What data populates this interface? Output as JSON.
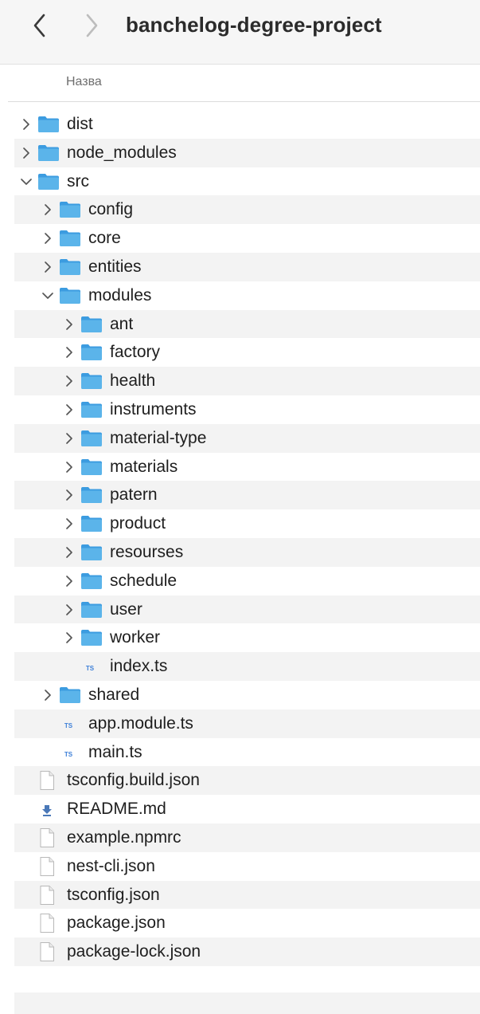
{
  "window": {
    "title": "banchelog-degree-project",
    "back_icon": "chevron-left-icon",
    "forward_icon": "chevron-right-icon"
  },
  "column_header": {
    "name": "Назва"
  },
  "colors": {
    "folder": "#5bb4ea",
    "folder_tab": "#3c9ce0",
    "stripe": "#f3f3f3",
    "ts_badge": "#3d7fd8"
  },
  "rows": [
    {
      "name": "dist",
      "kind": "folder",
      "depth": 0,
      "state": "collapsed"
    },
    {
      "name": "node_modules",
      "kind": "folder",
      "depth": 0,
      "state": "collapsed"
    },
    {
      "name": "src",
      "kind": "folder",
      "depth": 0,
      "state": "expanded"
    },
    {
      "name": "config",
      "kind": "folder",
      "depth": 1,
      "state": "collapsed"
    },
    {
      "name": "core",
      "kind": "folder",
      "depth": 1,
      "state": "collapsed"
    },
    {
      "name": "entities",
      "kind": "folder",
      "depth": 1,
      "state": "collapsed"
    },
    {
      "name": "modules",
      "kind": "folder",
      "depth": 1,
      "state": "expanded"
    },
    {
      "name": "ant",
      "kind": "folder",
      "depth": 2,
      "state": "collapsed"
    },
    {
      "name": "factory",
      "kind": "folder",
      "depth": 2,
      "state": "collapsed"
    },
    {
      "name": "health",
      "kind": "folder",
      "depth": 2,
      "state": "collapsed"
    },
    {
      "name": "instruments",
      "kind": "folder",
      "depth": 2,
      "state": "collapsed"
    },
    {
      "name": "material-type",
      "kind": "folder",
      "depth": 2,
      "state": "collapsed"
    },
    {
      "name": "materials",
      "kind": "folder",
      "depth": 2,
      "state": "collapsed"
    },
    {
      "name": "patern",
      "kind": "folder",
      "depth": 2,
      "state": "collapsed"
    },
    {
      "name": "product",
      "kind": "folder",
      "depth": 2,
      "state": "collapsed"
    },
    {
      "name": "resourses",
      "kind": "folder",
      "depth": 2,
      "state": "collapsed"
    },
    {
      "name": "schedule",
      "kind": "folder",
      "depth": 2,
      "state": "collapsed"
    },
    {
      "name": "user",
      "kind": "folder",
      "depth": 2,
      "state": "collapsed"
    },
    {
      "name": "worker",
      "kind": "folder",
      "depth": 2,
      "state": "collapsed"
    },
    {
      "name": "index.ts",
      "kind": "ts",
      "depth": 2,
      "badge": "TS"
    },
    {
      "name": "shared",
      "kind": "folder",
      "depth": 1,
      "state": "collapsed"
    },
    {
      "name": "app.module.ts",
      "kind": "ts",
      "depth": 1,
      "badge": "TS"
    },
    {
      "name": "main.ts",
      "kind": "ts",
      "depth": 1,
      "badge": "TS"
    },
    {
      "name": "tsconfig.build.json",
      "kind": "doc",
      "depth": 0
    },
    {
      "name": "README.md",
      "kind": "md",
      "depth": 0
    },
    {
      "name": "example.npmrc",
      "kind": "doc",
      "depth": 0
    },
    {
      "name": "nest-cli.json",
      "kind": "doc",
      "depth": 0
    },
    {
      "name": "tsconfig.json",
      "kind": "doc",
      "depth": 0
    },
    {
      "name": "package.json",
      "kind": "doc",
      "depth": 0
    },
    {
      "name": "package-lock.json",
      "kind": "doc",
      "depth": 0
    }
  ]
}
